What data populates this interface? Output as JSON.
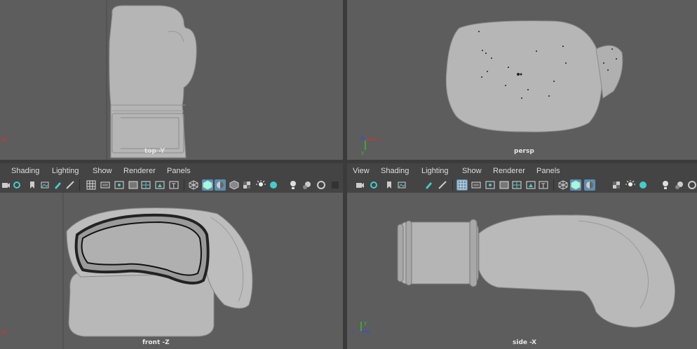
{
  "viewports": {
    "top": {
      "label": "top -Y"
    },
    "persp": {
      "label": "persp"
    },
    "front": {
      "label": "front -Z"
    },
    "side": {
      "label": "side -X"
    }
  },
  "left_panel_menu": {
    "shading": "Shading",
    "lighting": "Lighting",
    "show": "Show",
    "renderer": "Renderer",
    "panels": "Panels"
  },
  "right_panel_menu": {
    "view": "View",
    "shading": "Shading",
    "lighting": "Lighting",
    "show": "Show",
    "renderer": "Renderer",
    "panels": "Panels"
  },
  "axes": {
    "x": "x",
    "y": "y",
    "z": "z"
  },
  "colors": {
    "viewport_bg": "#5d5d5d",
    "mesh": "#b4b4b4",
    "toolbar_active": "#5b8fb0",
    "axis_x": "#d63030",
    "axis_y": "#30c030",
    "axis_z": "#3050e0"
  },
  "toolbar_icons": [
    "camera-select-icon",
    "camera-attributes-icon",
    "bookmark-icon",
    "image-plane-icon",
    "grease-pencil-icon",
    "2d-pan-zoom-icon",
    "grid-icon",
    "film-gate-icon",
    "resolution-gate-icon",
    "gate-mask-icon",
    "field-chart-icon",
    "safe-action-icon",
    "safe-title-icon",
    "wireframe-icon",
    "smooth-shade-icon",
    "xray-icon",
    "use-default-material-icon",
    "textured-icon",
    "use-all-lights-icon",
    "shadows-icon",
    "isolate-select-icon",
    "xray-joints-icon",
    "xray-active-icon"
  ]
}
